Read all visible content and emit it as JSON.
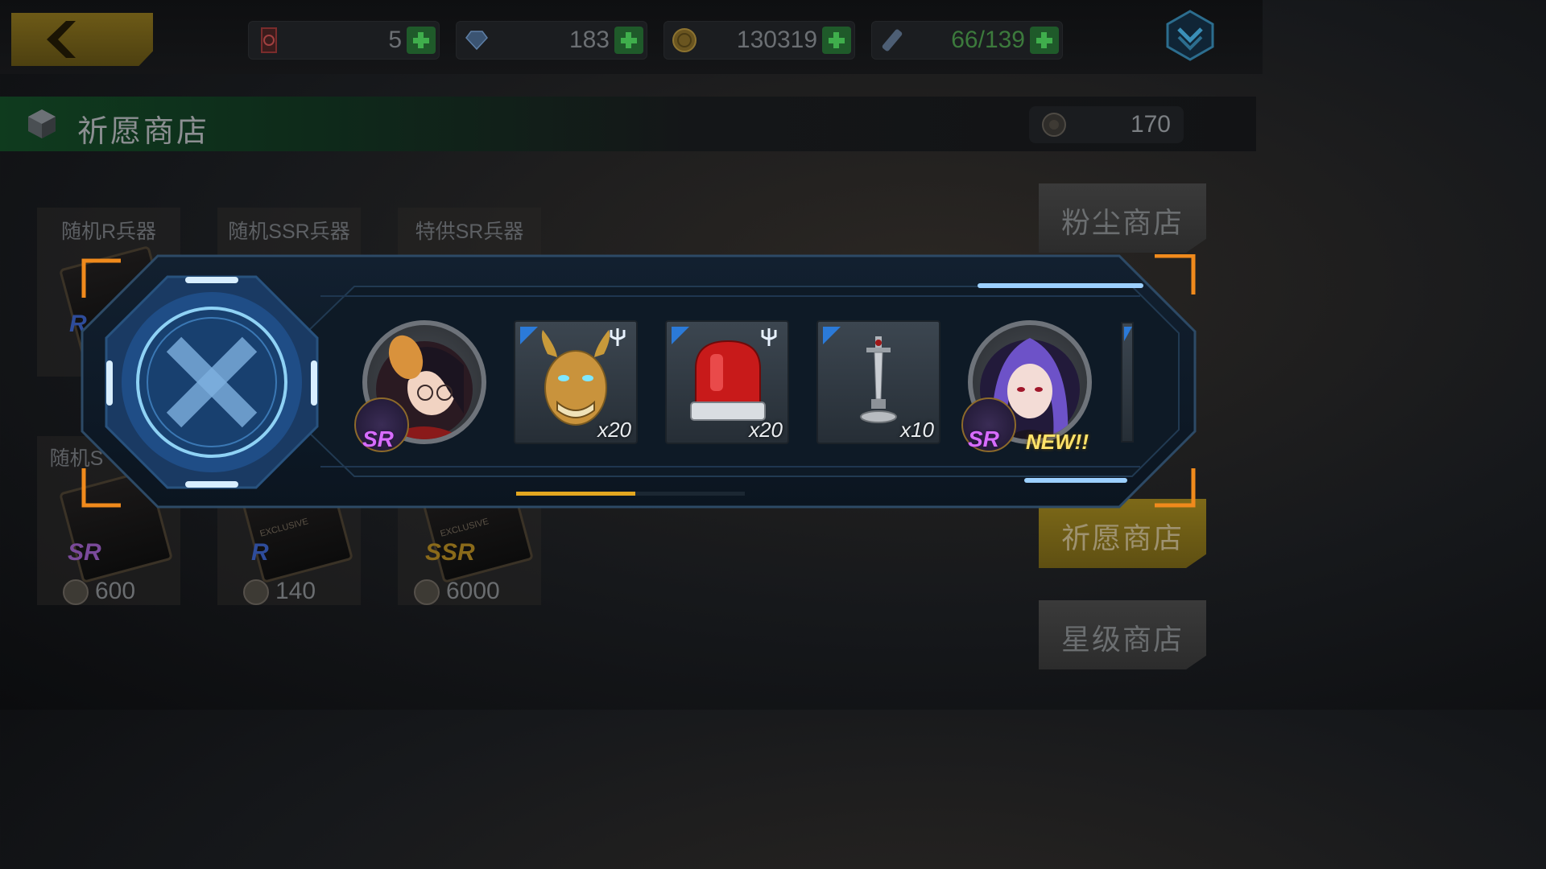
{
  "topbar": {
    "resources": [
      {
        "name": "ticket",
        "value": "5"
      },
      {
        "name": "diamond",
        "value": "183"
      },
      {
        "name": "gold",
        "value": "130319"
      },
      {
        "name": "stamina",
        "value": "66/139"
      }
    ]
  },
  "header": {
    "title": "祈愿商店",
    "currency_value": "170"
  },
  "shop_items": [
    {
      "label": "随机R兵器",
      "rank": "R",
      "price": ""
    },
    {
      "label": "随机SSR兵器",
      "rank": "",
      "price": ""
    },
    {
      "label": "特供SR兵器",
      "rank": "",
      "price": ""
    },
    {
      "label": "随机S",
      "rank": "SR",
      "price": "600"
    },
    {
      "label": "",
      "rank": "R",
      "price": "140",
      "tag": "EXCLUSIVE"
    },
    {
      "label": "",
      "rank": "SSR",
      "price": "6000",
      "tag": "EXCLUSIVE"
    }
  ],
  "side_tabs": [
    {
      "label": "粉尘商店",
      "active": false
    },
    {
      "label": "祈愿商店",
      "active": true
    },
    {
      "label": "星级商店",
      "active": false
    }
  ],
  "popup": {
    "rewards": [
      {
        "type": "character",
        "rarity": "SR",
        "icon": "masked-girl-portrait"
      },
      {
        "type": "item",
        "icon": "golden-oni-mask-icon",
        "qty": "x20"
      },
      {
        "type": "item",
        "icon": "red-siren-icon",
        "qty": "x20"
      },
      {
        "type": "item",
        "icon": "sword-trophy-icon",
        "qty": "x10"
      },
      {
        "type": "character",
        "rarity": "SR",
        "icon": "purple-hair-girl-portrait",
        "new_label": "NEW!!"
      }
    ],
    "scroll_progress": 0.52
  },
  "colors": {
    "accent_orange": "#f08a1c",
    "progress": "#e3a720",
    "plus_green": "#3fae4c",
    "sr_purple": "#d86cff"
  }
}
